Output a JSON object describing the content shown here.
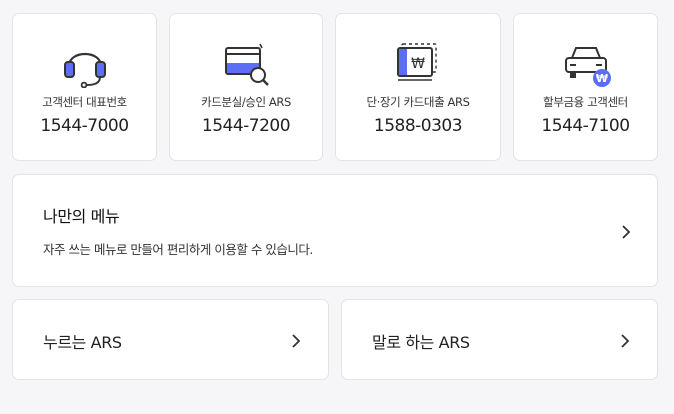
{
  "contacts": [
    {
      "label": "고객센터 대표번호",
      "phone": "1544-7000",
      "icon": "headset-icon"
    },
    {
      "label": "카드분실/승인 ARS",
      "phone": "1544-7200",
      "icon": "card-search-icon"
    },
    {
      "label": "단·장기 카드대출 ARS",
      "phone": "1588-0303",
      "icon": "card-loan-icon"
    },
    {
      "label": "할부금융 고객센터",
      "phone": "1544-7100",
      "icon": "car-finance-icon"
    }
  ],
  "my_menu": {
    "title": "나만의 메뉴",
    "description": "자주 쓰는 메뉴로 만들어 편리하게 이용할 수 있습니다."
  },
  "ars": {
    "press_label": "누르는 ARS",
    "voice_label": "말로 하는 ARS"
  },
  "colors": {
    "accent": "#5b6ef5",
    "icon_dark": "#333333",
    "background": "#f6f6f8"
  }
}
